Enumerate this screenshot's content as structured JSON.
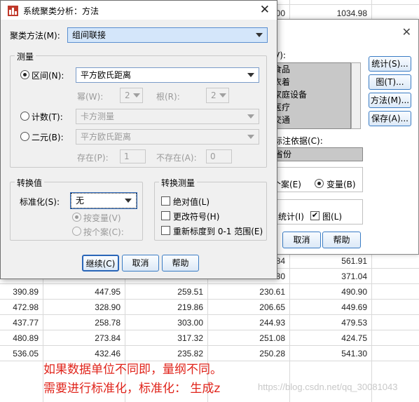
{
  "sheet": {
    "rows_top": [
      {
        "c4": "",
        "c5": "",
        "c6": "",
        "c7": "00",
        "c8": "1034.98"
      }
    ],
    "rows": [
      [
        "",
        "",
        "",
        "84",
        "561.91"
      ],
      [
        "",
        "",
        "",
        "30",
        "371.04"
      ],
      [
        "390.89",
        "447.95",
        "259.51",
        "230.61",
        "490.90"
      ],
      [
        "472.98",
        "328.90",
        "219.86",
        "206.65",
        "449.69"
      ],
      [
        "437.77",
        "258.78",
        "303.00",
        "244.93",
        "479.53"
      ],
      [
        "480.89",
        "273.84",
        "317.32",
        "251.08",
        "424.75"
      ],
      [
        "536.05",
        "432.46",
        "235.82",
        "250.28",
        "541.30"
      ]
    ],
    "annotation_line1": "如果数据单位不同即，量纲不同。",
    "annotation_line2": "需要进行标准化，标准化：  生成z",
    "watermark": "https://blog.csdn.net/qq_30081043"
  },
  "back_dialog": {
    "vars_label": "V):",
    "list_items": [
      "食品",
      "衣着",
      "家庭设备",
      "医疗",
      "交通"
    ],
    "buttons": [
      "统计(S)...",
      "图(T)...",
      "方法(M)...",
      "保存(A)..."
    ],
    "label_case_label": "标注依据(C):",
    "label_case_value": "省份",
    "cluster_case": "个案(E)",
    "cluster_var": "变量(B)",
    "display_stats": "统计(I)",
    "display_plots": "图(L)",
    "btn_cancel": "取消",
    "btn_help": "帮助"
  },
  "dialog": {
    "title": "系统聚类分析：方法",
    "cluster_method_label": "聚类方法(M):",
    "cluster_method_value": "组间联接",
    "measure_group": "测量",
    "interval_label": "区间(N):",
    "interval_value": "平方欧氏距离",
    "power_label": "幂(W):",
    "power_value": "2",
    "root_label": "根(R):",
    "root_value": "2",
    "counts_label": "计数(T):",
    "counts_value": "卡方测量",
    "binary_label": "二元(B):",
    "binary_value": "平方欧氏距离",
    "present_label": "存在(P):",
    "present_value": "1",
    "absent_label": "不存在(A):",
    "absent_value": "0",
    "transform_values_group": "转换值",
    "standardize_label": "标准化(S):",
    "standardize_value": "无",
    "by_variable": "按变量(V)",
    "by_case": "按个案(C):",
    "transform_measures_group": "转换测量",
    "abs_values": "绝对值(L)",
    "change_sign": "更改符号(H)",
    "rescale": "重新标度到 0-1 范围(E)",
    "btn_continue": "继续(C)",
    "btn_cancel": "取消",
    "btn_help": "帮助"
  }
}
